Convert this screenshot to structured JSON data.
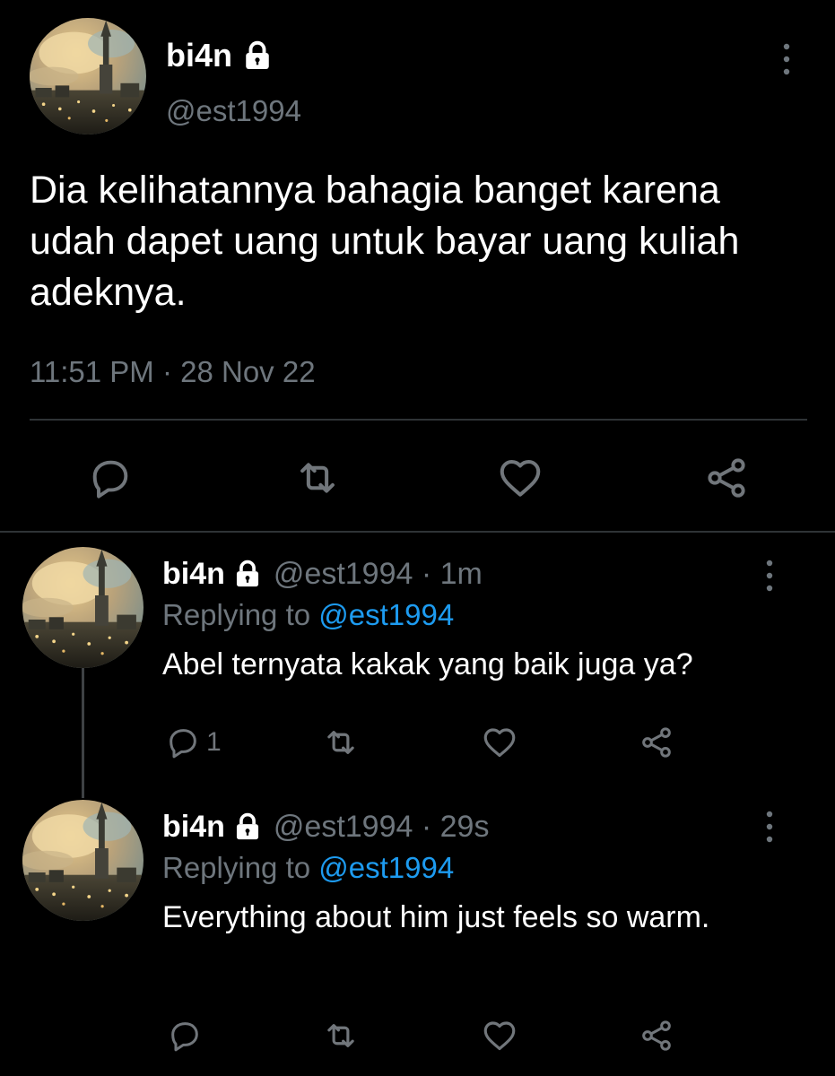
{
  "main_tweet": {
    "display_name": "bi4n",
    "handle": "@est1994",
    "text": "Dia kelihatannya bahagia banget karena udah dapet uang untuk bayar uang kuliah adeknya.",
    "timestamp": "11:51 PM · 28 Nov 22",
    "icons": [
      "reply-icon",
      "retweet-icon",
      "like-icon",
      "share-icon",
      "more-icon",
      "lock-icon"
    ]
  },
  "replies": [
    {
      "display_name": "bi4n",
      "meta": "@est1994 · 1m",
      "replying_prefix": "Replying to",
      "replying_to": "@est1994",
      "text": "Abel ternyata kakak yang baik juga ya?",
      "reply_count": "1"
    },
    {
      "display_name": "bi4n",
      "meta": "@est1994 · 29s",
      "replying_prefix": "Replying to",
      "replying_to": "@est1994",
      "text": "Everything about him just feels so warm."
    }
  ],
  "colors": {
    "background": "#000000",
    "text_primary": "#ffffff",
    "text_secondary": "#6e767d",
    "accent": "#1d9bf0",
    "divider": "#2f3336"
  }
}
